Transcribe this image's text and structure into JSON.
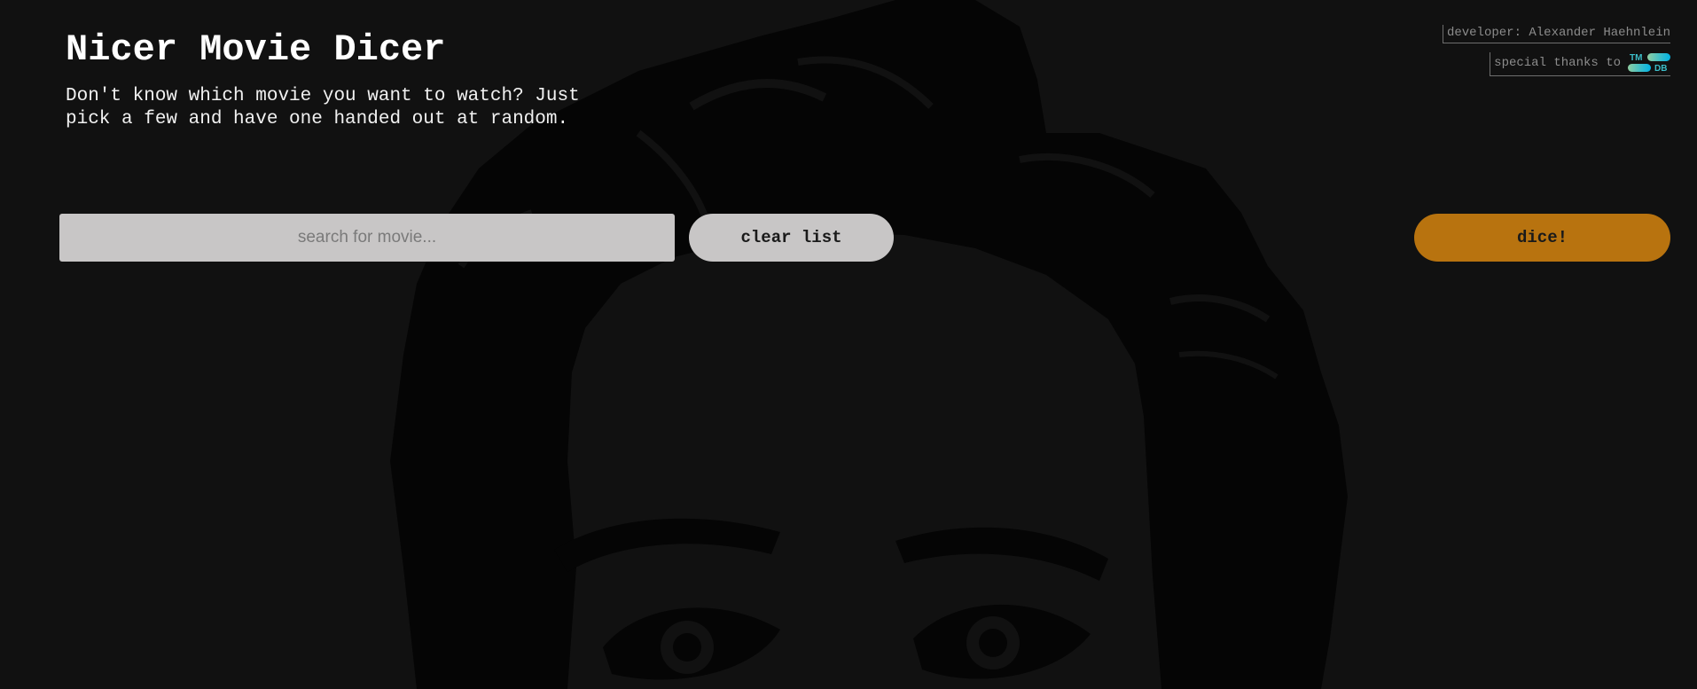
{
  "app": {
    "title": "Nicer Movie Dicer",
    "subtitle": "Don't know which movie you want to watch? Just pick a few and have one handed out at random."
  },
  "credits": {
    "developer": "developer: Alexander Haehnlein",
    "thanks": "special thanks to",
    "tmdb_top": "TM",
    "tmdb_bottom": "DB",
    "tmdb_colors": [
      "#90cea1",
      "#3cbec9",
      "#00b3e5"
    ]
  },
  "search": {
    "placeholder": "search for movie...",
    "value": ""
  },
  "buttons": {
    "clear": "clear list",
    "dice": "dice!"
  },
  "colors": {
    "background": "#111111",
    "accent": "#b8730f",
    "control_gray": "#c8c6c6"
  }
}
